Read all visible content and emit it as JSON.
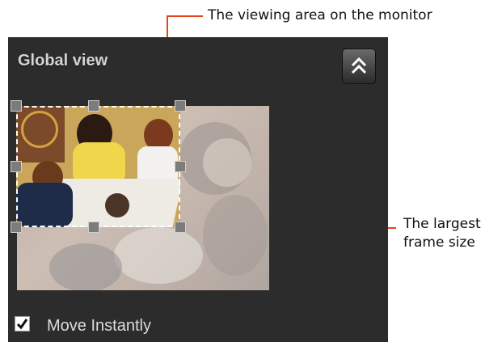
{
  "panel": {
    "title": "Global view",
    "collapse_icon": "double-chevron-up-icon"
  },
  "move_instantly": {
    "label": "Move Instantly",
    "checked": true,
    "icon": "checkmark-icon"
  },
  "callouts": {
    "viewing_area": "The viewing area on the monitor",
    "largest_frame_line1": "The largest",
    "largest_frame_line2": "frame size"
  },
  "colors": {
    "leader_line": "#e8431f",
    "panel_bg": "#2c2c2c"
  }
}
